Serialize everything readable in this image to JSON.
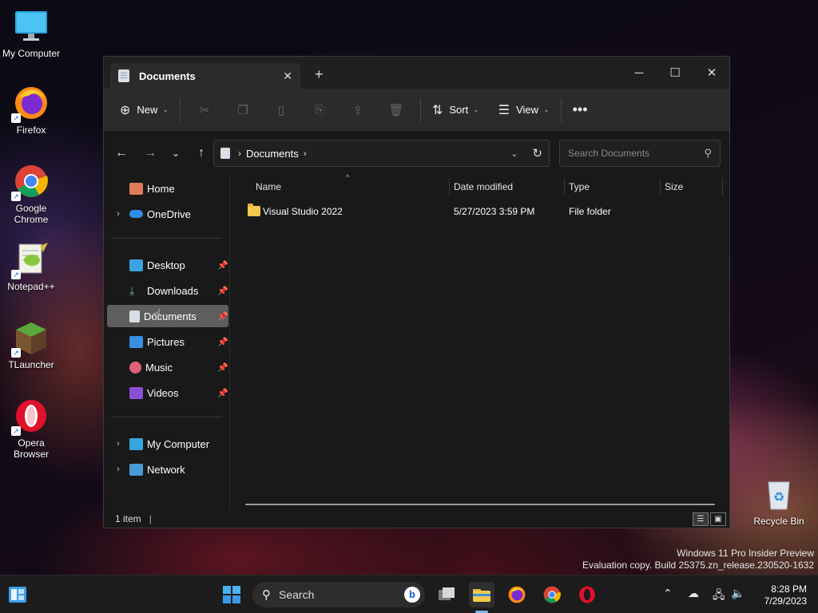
{
  "desktop": {
    "icons": [
      {
        "label": "My Computer"
      },
      {
        "label": "Firefox"
      },
      {
        "label": "Google Chrome"
      },
      {
        "label": "Notepad++"
      },
      {
        "label": "TLauncher"
      },
      {
        "label": "Opera Browser"
      },
      {
        "label": "Recycle Bin"
      }
    ],
    "watermark": {
      "line1": "Windows 11 Pro Insider Preview",
      "line2": "Evaluation copy. Build 25375.zn_release.230520-1632"
    }
  },
  "explorer": {
    "tab": {
      "label": "Documents"
    },
    "toolbar": {
      "new_label": "New",
      "sort_label": "Sort",
      "view_label": "View"
    },
    "address": {
      "segment": "Documents"
    },
    "search": {
      "placeholder": "Search Documents"
    },
    "sidebar": {
      "items": [
        {
          "label": "Home"
        },
        {
          "label": "OneDrive"
        },
        {
          "label": "Desktop"
        },
        {
          "label": "Downloads"
        },
        {
          "label": "Documents"
        },
        {
          "label": "Pictures"
        },
        {
          "label": "Music"
        },
        {
          "label": "Videos"
        },
        {
          "label": "My Computer"
        },
        {
          "label": "Network"
        }
      ]
    },
    "columns": {
      "name": "Name",
      "date_modified": "Date modified",
      "type": "Type",
      "size": "Size"
    },
    "files": [
      {
        "name": "Visual Studio 2022",
        "date_modified": "5/27/2023 3:59 PM",
        "type": "File folder",
        "size": ""
      }
    ],
    "status": {
      "item_count": "1 item"
    }
  },
  "taskbar": {
    "search_label": "Search",
    "time": "8:28 PM",
    "date": "7/29/2023"
  },
  "colors": {
    "accent": "#7fb4e6",
    "selection": "#5e5e5e",
    "folder": "#f5c94c"
  }
}
